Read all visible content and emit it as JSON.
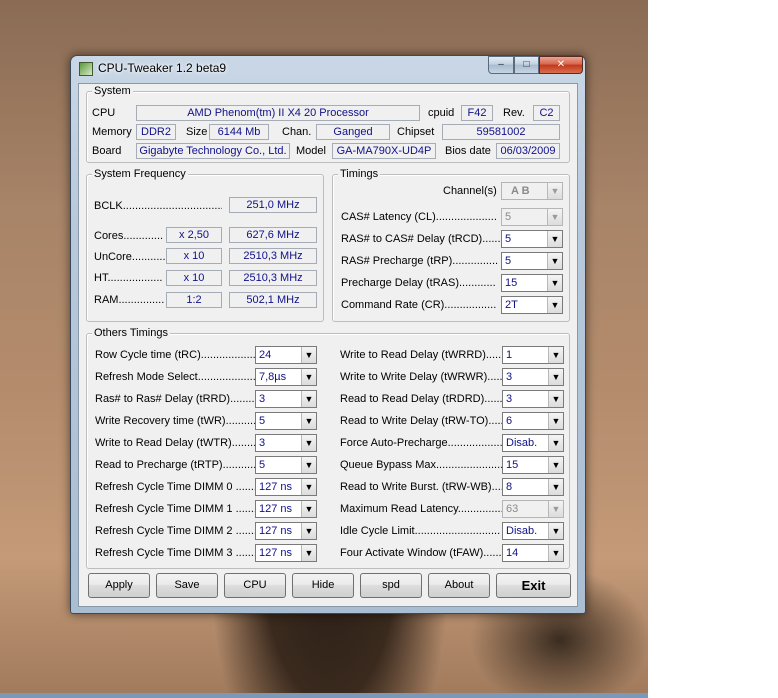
{
  "window": {
    "title": "CPU-Tweaker 1.2 beta9",
    "caption_buttons": {
      "minimize": "–",
      "maximize": "□",
      "close": "✕"
    }
  },
  "system": {
    "group_title": "System",
    "cpu_label": "CPU",
    "cpu_value": "AMD Phenom(tm) II X4 20 Processor",
    "cpuid_label": "cpuid",
    "cpuid_value": "F42",
    "rev_label": "Rev.",
    "rev_value": "C2",
    "memory_label": "Memory",
    "memory_value": "DDR2",
    "size_label": "Size",
    "size_value": "6144 Mb",
    "chan_label": "Chan.",
    "chan_value": "Ganged",
    "chipset_label": "Chipset",
    "chipset_value": "59581002",
    "board_label": "Board",
    "board_value": "Gigabyte Technology Co., Ltd.",
    "model_label": "Model",
    "model_value": "GA-MA790X-UD4P",
    "bios_label": "Bios date",
    "bios_value": "06/03/2009"
  },
  "frequency": {
    "group_title": "System Frequency",
    "bclk_label": "BCLK.....................................",
    "bclk_value": "251,0 MHz",
    "rows": [
      {
        "label": "Cores.............",
        "mult": "x 2,50",
        "value": "627,6 MHz"
      },
      {
        "label": "UnCore...........",
        "mult": "x 10",
        "value": "2510,3 MHz"
      },
      {
        "label": "HT..................",
        "mult": "x 10",
        "value": "2510,3 MHz"
      },
      {
        "label": "RAM...............",
        "mult": "1:2",
        "value": "502,1 MHz"
      }
    ]
  },
  "timings": {
    "group_title": "Timings",
    "channel_label": "Channel(s)",
    "channel_value": "A  B",
    "rows": [
      {
        "label": "CAS# Latency (CL)....................",
        "value": "5",
        "disabled": true
      },
      {
        "label": "RAS# to CAS# Delay (tRCD)........",
        "value": "5",
        "disabled": false
      },
      {
        "label": "RAS# Precharge (tRP)...............",
        "value": "5",
        "disabled": false
      },
      {
        "label": "Precharge Delay (tRAS)............",
        "value": "15",
        "disabled": false
      },
      {
        "label": "Command Rate (CR).................",
        "value": "2T",
        "disabled": false
      }
    ]
  },
  "others": {
    "group_title": "Others Timings",
    "left": [
      {
        "label": "Row Cycle time (tRC)..................",
        "value": "24"
      },
      {
        "label": "Refresh Mode Select...................",
        "value": "7,8µs"
      },
      {
        "label": "Ras# to Ras# Delay (tRRD)..........",
        "value": "3"
      },
      {
        "label": "Write Recovery time (tWR)...........",
        "value": "5"
      },
      {
        "label": "Write to Read Delay (tWTR)..........",
        "value": "3"
      },
      {
        "label": "Read to Precharge (tRTP)............",
        "value": "5"
      },
      {
        "label": "Refresh Cycle Time  DIMM 0 .......",
        "value": "127 ns"
      },
      {
        "label": "Refresh Cycle Time  DIMM 1 .......",
        "value": "127 ns"
      },
      {
        "label": "Refresh Cycle Time  DIMM 2 .......",
        "value": "127 ns"
      },
      {
        "label": "Refresh Cycle Time  DIMM 3 .......",
        "value": "127 ns"
      }
    ],
    "right": [
      {
        "label": "Write to Read Delay (tWRRD)........",
        "value": "1",
        "disabled": false
      },
      {
        "label": "Write to Write Delay (tWRWR)........",
        "value": "3",
        "disabled": false
      },
      {
        "label": "Read to Read Delay (tRDRD)..........",
        "value": "3",
        "disabled": false
      },
      {
        "label": "Read to Write Delay (tRW-TO).........",
        "value": "6",
        "disabled": false
      },
      {
        "label": "Force Auto-Precharge...................",
        "value": "Disab.",
        "disabled": false
      },
      {
        "label": "Queue Bypass Max.......................",
        "value": "15",
        "disabled": false
      },
      {
        "label": "Read to Write Burst. (tRW-WB).......",
        "value": "8",
        "disabled": false
      },
      {
        "label": "Maximum Read Latency................",
        "value": "63",
        "disabled": true
      },
      {
        "label": "Idle Cycle Limit............................",
        "value": "Disab.",
        "disabled": false
      },
      {
        "label": "Four Activate Window (tFAW)........",
        "value": "14",
        "disabled": false
      }
    ]
  },
  "buttons": {
    "apply": "Apply",
    "save": "Save",
    "cpu": "CPU",
    "hide": "Hide",
    "spd": "spd",
    "about": "About",
    "exit": "Exit"
  },
  "icons": {
    "dropdown": "chevron-down-icon",
    "app": "cpu-tweaker-app-icon"
  }
}
